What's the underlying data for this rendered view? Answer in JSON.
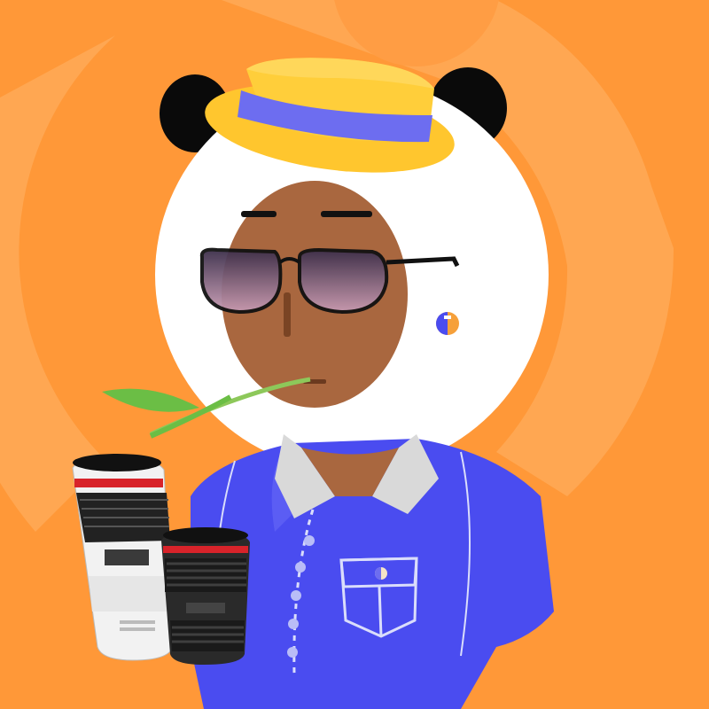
{
  "scene": {
    "description_icon": "panda-photographer-avatar"
  },
  "colors": {
    "background": "#FF9838",
    "background_ring": "#FFAE5E",
    "head": "#FFFFFF",
    "ear": "#0A0A0A",
    "face": "#A9673F",
    "hat": "#FFC62E",
    "hat_band": "#6D6DF0",
    "shirt": "#4A4CF0",
    "collar": "#D9D9D9",
    "button": "#B9BDF7",
    "leaf": "#6BBE45",
    "lens_white": "#F2F2F2",
    "lens_black": "#2A2A2A",
    "lens_red": "#D8232A"
  },
  "icons": [
    "hat-icon",
    "sunglasses-icon",
    "leaf-icon",
    "logo-icon",
    "camera-lens-icon"
  ]
}
